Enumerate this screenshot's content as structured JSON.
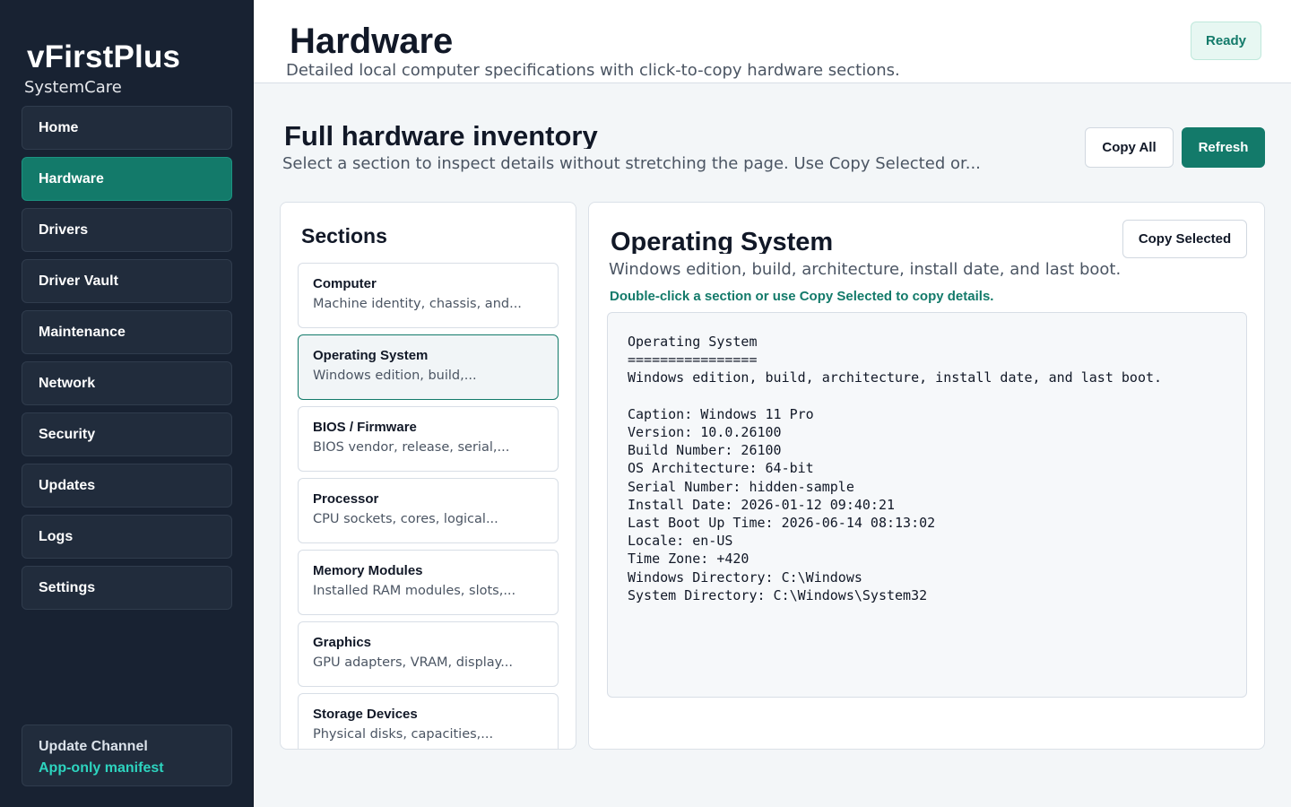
{
  "app": {
    "name": "vFirstPlus",
    "subtitle": "SystemCare"
  },
  "sidebar": {
    "items": [
      {
        "label": "Home",
        "active": false
      },
      {
        "label": "Hardware",
        "active": true
      },
      {
        "label": "Drivers",
        "active": false
      },
      {
        "label": "Driver Vault",
        "active": false
      },
      {
        "label": "Maintenance",
        "active": false
      },
      {
        "label": "Network",
        "active": false
      },
      {
        "label": "Security",
        "active": false
      },
      {
        "label": "Updates",
        "active": false
      },
      {
        "label": "Logs",
        "active": false
      },
      {
        "label": "Settings",
        "active": false
      }
    ],
    "channel": {
      "title": "Update Channel",
      "value": "App-only manifest"
    }
  },
  "header": {
    "title": "Hardware",
    "subtitle": "Detailed local computer specifications with click-to-copy hardware sections.",
    "status": "Ready"
  },
  "inventory": {
    "title": "Full hardware inventory",
    "subtitle": "Select a section to inspect details without stretching the page. Use Copy Selected or...",
    "copy_all_label": "Copy All",
    "refresh_label": "Refresh"
  },
  "sections": {
    "title": "Sections",
    "items": [
      {
        "name": "Computer",
        "desc": "Machine identity, chassis, and...",
        "active": false
      },
      {
        "name": "Operating System",
        "desc": "Windows edition, build,...",
        "active": true
      },
      {
        "name": "BIOS / Firmware",
        "desc": "BIOS vendor, release, serial,...",
        "active": false
      },
      {
        "name": "Processor",
        "desc": "CPU sockets, cores, logical...",
        "active": false
      },
      {
        "name": "Memory Modules",
        "desc": "Installed RAM modules, slots,...",
        "active": false
      },
      {
        "name": "Graphics",
        "desc": "GPU adapters, VRAM, display...",
        "active": false
      },
      {
        "name": "Storage Devices",
        "desc": "Physical disks, capacities,...",
        "active": false
      }
    ]
  },
  "detail": {
    "title": "Operating System",
    "subtitle": "Windows edition, build, architecture, install date, and last boot.",
    "hint": "Double-click a section or use Copy Selected to copy details.",
    "copy_selected_label": "Copy Selected",
    "content": "Operating System\n================\nWindows edition, build, architecture, install date, and last boot.\n\nCaption: Windows 11 Pro\nVersion: 10.0.26100\nBuild Number: 26100\nOS Architecture: 64-bit\nSerial Number: hidden-sample\nInstall Date: 2026-01-12 09:40:21\nLast Boot Up Time: 2026-06-14 08:13:02\nLocale: en-US\nTime Zone: +420\nWindows Directory: C:\\Windows\nSystem Directory: C:\\Windows\\System32"
  },
  "colors": {
    "accent": "#137a6a",
    "sidebar_bg": "#182232",
    "hint": "#2dd4bf"
  }
}
